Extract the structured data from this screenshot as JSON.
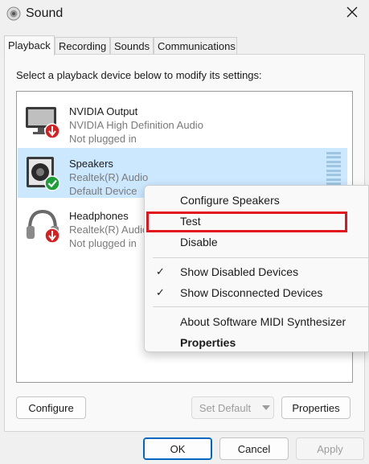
{
  "window": {
    "title": "Sound"
  },
  "tabs": [
    {
      "label": "Playback",
      "active": true
    },
    {
      "label": "Recording",
      "active": false
    },
    {
      "label": "Sounds",
      "active": false
    },
    {
      "label": "Communications",
      "active": false
    }
  ],
  "instruction": "Select a playback device below to modify its settings:",
  "devices": [
    {
      "name": "NVIDIA Output",
      "driver": "NVIDIA High Definition Audio",
      "status": "Not plugged in",
      "icon": "monitor-icon",
      "badge": "unplugged-badge-icon",
      "selected": false
    },
    {
      "name": "Speakers",
      "driver": "Realtek(R) Audio",
      "status": "Default Device",
      "icon": "speaker-icon",
      "badge": "default-check-badge-icon",
      "selected": true
    },
    {
      "name": "Headphones",
      "driver": "Realtek(R) Audio",
      "status": "Not plugged in",
      "icon": "headphones-icon",
      "badge": "unplugged-badge-icon",
      "selected": false
    }
  ],
  "context_menu": {
    "items": [
      {
        "label": "Configure Speakers",
        "checked": false,
        "bold": false
      },
      {
        "label": "Test",
        "checked": false,
        "bold": false,
        "highlighted": true
      },
      {
        "label": "Disable",
        "checked": false,
        "bold": false
      },
      {
        "label": "Show Disabled Devices",
        "checked": true,
        "bold": false
      },
      {
        "label": "Show Disconnected Devices",
        "checked": true,
        "bold": false
      },
      {
        "label": "About Software MIDI Synthesizer",
        "checked": false,
        "bold": false
      },
      {
        "label": "Properties",
        "checked": false,
        "bold": true
      }
    ],
    "check_glyph": "✓"
  },
  "buttons": {
    "configure": "Configure",
    "set_default": "Set Default",
    "properties": "Properties",
    "ok": "OK",
    "cancel": "Cancel",
    "apply": "Apply"
  },
  "colors": {
    "selection": "#cce8ff",
    "highlight_border": "#e2141e",
    "default_badge": "#1e9e3a",
    "unplugged_badge": "#d42020"
  }
}
